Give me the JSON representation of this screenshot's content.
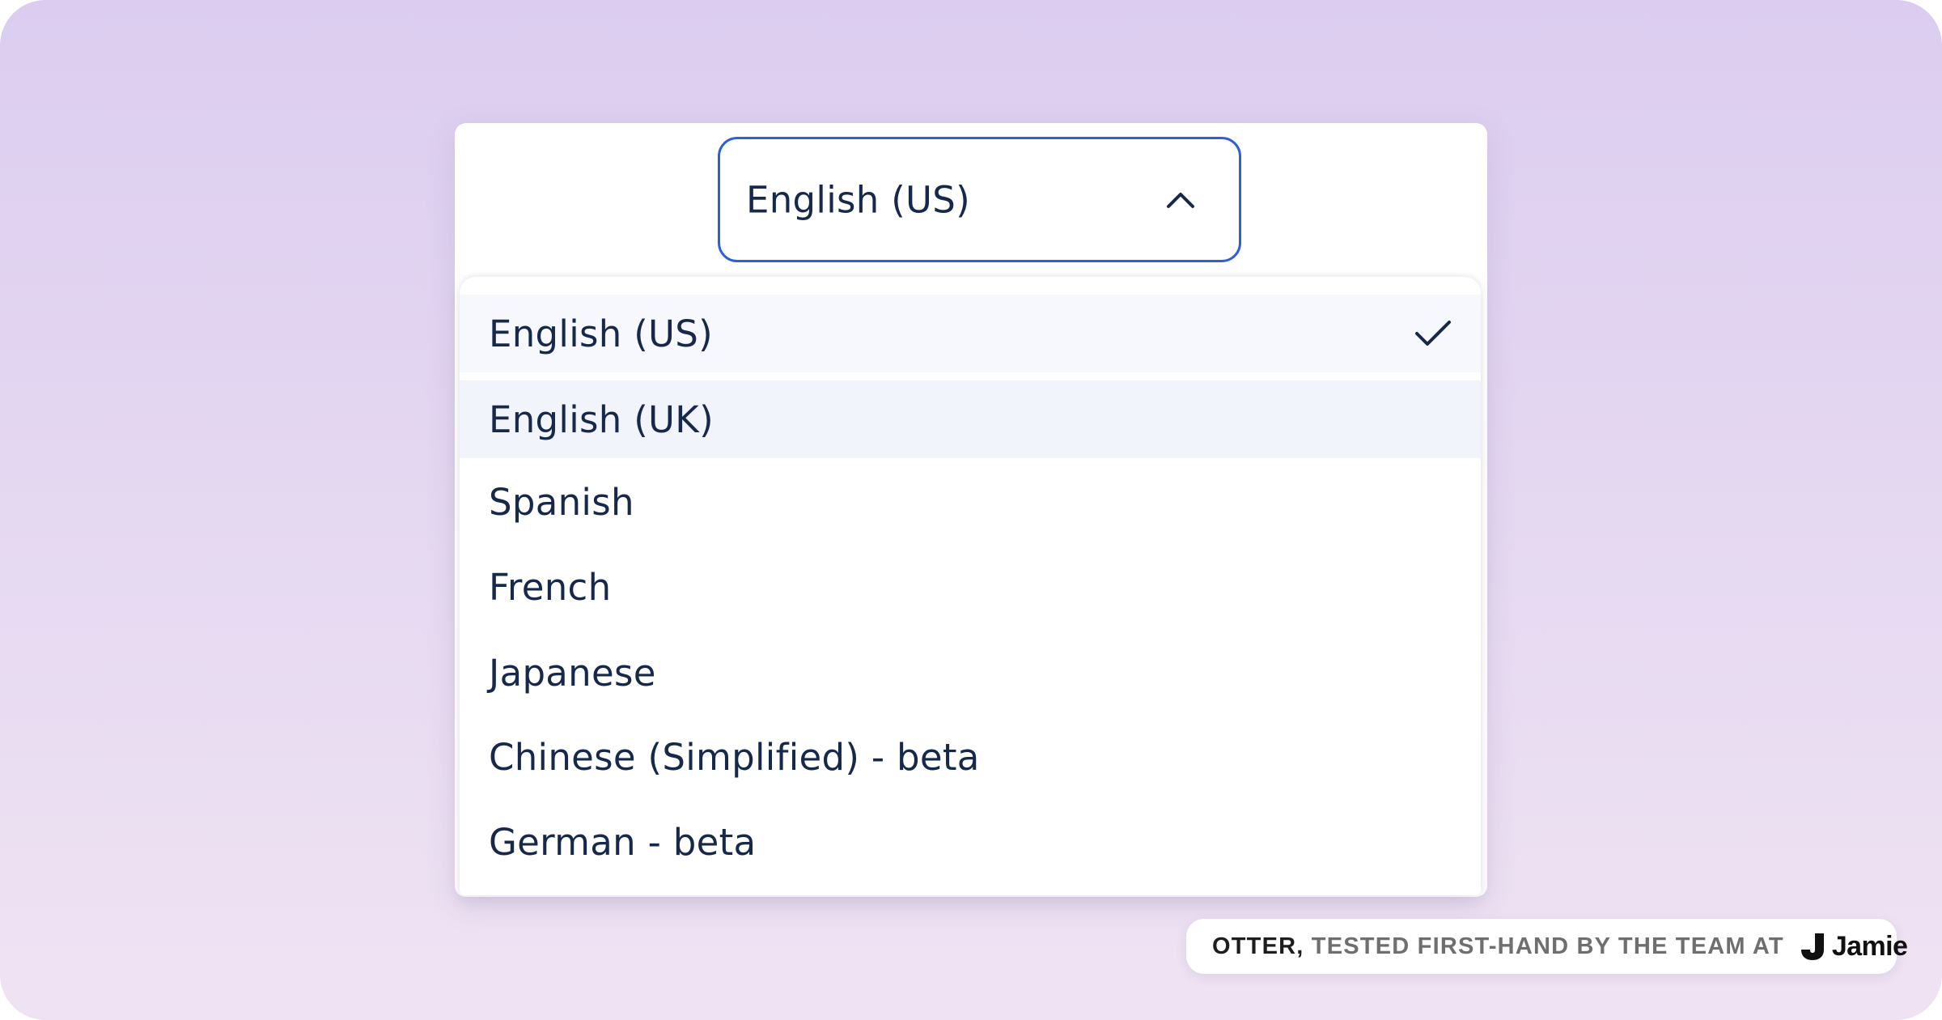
{
  "language_select": {
    "value": "English (US)",
    "expanded": true,
    "accent_color": "#2f5fd6",
    "toggle_icon": "chevron-up-icon"
  },
  "dropdown": {
    "options": [
      {
        "label": "English (US)",
        "selected": true,
        "icon": "check-icon"
      },
      {
        "label": "English (UK)",
        "selected": false,
        "hovered": true
      },
      {
        "label": "Spanish",
        "selected": false
      },
      {
        "label": "French",
        "selected": false
      },
      {
        "label": "Japanese",
        "selected": false
      },
      {
        "label": "Chinese (Simplified) - beta",
        "selected": false
      },
      {
        "label": "German - beta",
        "selected": false
      }
    ]
  },
  "credit": {
    "product": "OTTER,",
    "text": "TESTED FIRST-HAND BY THE TEAM AT",
    "brand_name": "Jamie",
    "brand_icon": "jamie-logo-icon"
  },
  "colors": {
    "text": "#16294a",
    "background_top": "#dccdf0",
    "background_bottom": "#efe3f3"
  }
}
